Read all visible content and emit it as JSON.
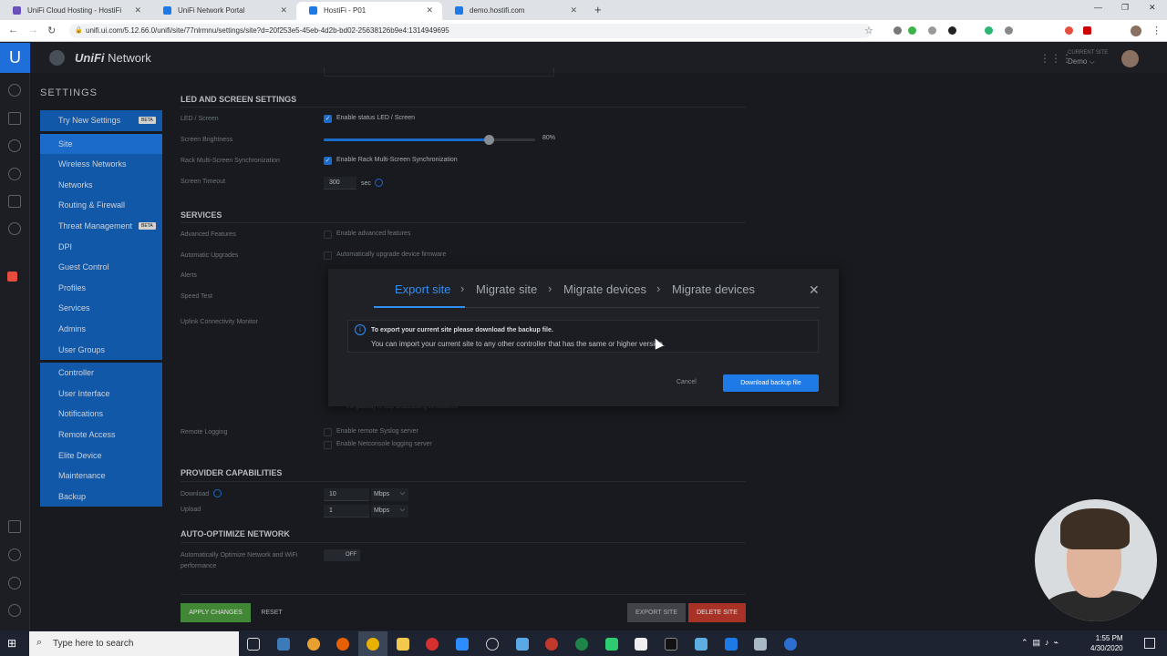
{
  "browser": {
    "tabs": [
      {
        "title": "UniFi Cloud Hosting - HostiFi",
        "color": "#6b4fbb"
      },
      {
        "title": "UniFi Network Portal",
        "color": "#1e7ae6"
      },
      {
        "title": "HostiFi - P01",
        "color": "#1e7ae6"
      },
      {
        "title": "demo.hostifi.com",
        "color": "#1e7ae6"
      }
    ],
    "url": "unifi.ui.com/5.12.66.0/unifi/site/77nlrmnu/settings/site?d=20f253e5-45eb-4d2b-bd02-25638126b9e4:1314949695"
  },
  "app": {
    "brand_bold": "UniFi",
    "brand_rest": " Network",
    "current_site_label": "CURRENT SITE",
    "current_site": "Demo ⌵"
  },
  "settings_title": "SETTINGS",
  "menu": [
    {
      "label": "Try New Settings",
      "badge": "BETA"
    },
    {
      "label": "Site",
      "selected": true
    },
    {
      "label": "Wireless Networks"
    },
    {
      "label": "Networks"
    },
    {
      "label": "Routing & Firewall"
    },
    {
      "label": "Threat Management",
      "badge": "BETA"
    },
    {
      "label": "DPI"
    },
    {
      "label": "Guest Control"
    },
    {
      "label": "Profiles"
    },
    {
      "label": "Services"
    },
    {
      "label": "Admins"
    },
    {
      "label": "User Groups"
    },
    {
      "label": "Controller"
    },
    {
      "label": "User Interface"
    },
    {
      "label": "Notifications"
    },
    {
      "label": "Remote Access"
    },
    {
      "label": "Elite Device"
    },
    {
      "label": "Maintenance"
    },
    {
      "label": "Backup"
    }
  ],
  "led": {
    "heading": "LED AND SCREEN SETTINGS",
    "led_label": "LED / Screen",
    "led_option": "Enable status LED / Screen",
    "brightness_label": "Screen Brightness",
    "brightness_value": "80%",
    "brightness_fraction": 0.8,
    "rack_label": "Rack Multi-Screen Synchronization",
    "rack_option": "Enable Rack Multi-Screen Synchronization",
    "timeout_label": "Screen Timeout",
    "timeout_value": "300",
    "timeout_unit": "sec"
  },
  "services": {
    "heading": "SERVICES",
    "advanced_label": "Advanced Features",
    "advanced_option": "Enable advanced features",
    "upgrades_label": "Automatic Upgrades",
    "upgrades_option": "Automatically upgrade device firmware",
    "alerts_label": "Alerts",
    "speed_label": "Speed Test",
    "uplink_label": "Uplink Connectivity Monitor",
    "uplink_note": "the gateway to stop broadcasting its networks.",
    "remote_label": "Remote Logging",
    "syslog_option": "Enable remote Syslog server",
    "netconsole_option": "Enable Netconsole logging server"
  },
  "provider": {
    "heading": "PROVIDER CAPABILITIES",
    "download_label": "Download",
    "download_value": "10",
    "upload_label": "Upload",
    "upload_value": "1",
    "unit": "Mbps"
  },
  "autoopt": {
    "heading": "AUTO-OPTIMIZE NETWORK",
    "label_line1": "Automatically Optimize Network and WiFi",
    "label_line2": "performance",
    "toggle": "OFF"
  },
  "footer": {
    "apply": "APPLY CHANGES",
    "reset": "RESET",
    "export": "EXPORT SITE",
    "delete": "DELETE SITE"
  },
  "modal": {
    "steps": [
      "Export site",
      "Migrate site",
      "Migrate devices",
      "Migrate devices"
    ],
    "info_title": "To export your current site please download the backup file.",
    "info_body": "You can import your current site to any other controller that has the same or higher version.",
    "cancel": "Cancel",
    "download": "Download backup file"
  },
  "taskbar": {
    "search_placeholder": "Type here to search",
    "time": "1:55 PM",
    "date": "4/30/2020"
  },
  "colors": {
    "accent": "#1e7ae6",
    "menu": "#1565c0",
    "apply": "#4c9a3e",
    "delete": "#c0392b"
  }
}
